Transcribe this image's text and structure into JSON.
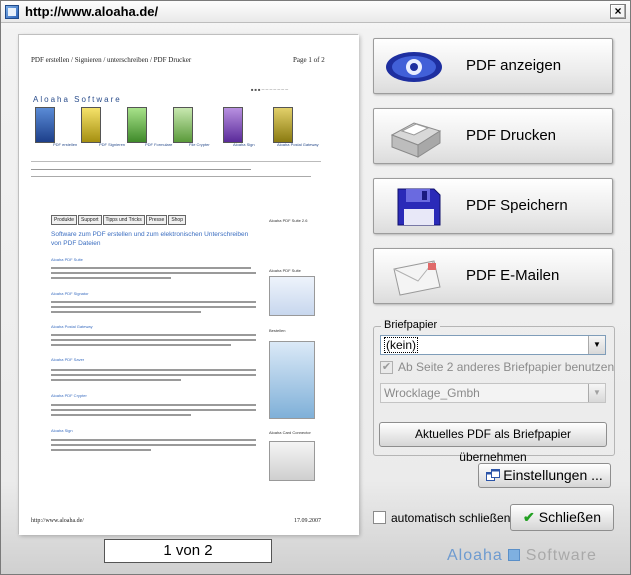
{
  "window": {
    "title": "http://www.aloaha.de/",
    "close_glyph": "×"
  },
  "preview": {
    "header_left": "PDF erstellen / Signieren / unterschreiben / PDF Drucker",
    "header_right": "Page 1 of 2",
    "logo": "Aloaha Software",
    "footer_left": "http://www.aloaha.de/",
    "footer_right": "17.09.2007",
    "products": [
      "PDF erstellen",
      "PDF Signieren",
      "PDF Formulare",
      "File Crypter",
      "Aloaha Sign",
      "Aloaha Postal Gateway"
    ],
    "tabs": [
      "Produkte",
      "Support",
      "Tipps und Tricks",
      "Presse",
      "Shop"
    ],
    "heading": "Software zum PDF erstellen und zum elektronischen Unterschreiben von PDF Dateien",
    "sections": [
      "Aloaha PDF Suite",
      "Aloaha PDF Signator",
      "Aloaha Postal Gateway",
      "Aloaha PDF Saver",
      "Aloaha PDF Crypter",
      "Aloaha Sign"
    ],
    "side_labels": [
      "Aloaha PDF Suite 2.6",
      "Aloaha PDF Suite",
      "Bestellen",
      "Aloaha Card Connector"
    ]
  },
  "page_counter": "1 von 2",
  "actions": [
    {
      "label": "PDF anzeigen",
      "icon": "eye-icon"
    },
    {
      "label": "PDF Drucken",
      "icon": "printer-icon"
    },
    {
      "label": "PDF Speichern",
      "icon": "floppy-disk-icon"
    },
    {
      "label": "PDF E-Mailen",
      "icon": "envelope-icon"
    }
  ],
  "briefpapier": {
    "group_label": "Briefpapier",
    "selected": "(kein)",
    "page2_checkbox_label": "Ab Seite 2 anderes Briefpapier benutzen",
    "page2_checked": true,
    "page2_selected": "Wrocklage_Gmbh",
    "apply_button": "Aktuelles PDF als Briefpapier übernehmen"
  },
  "settings_button": "Einstellungen ...",
  "auto_close_label": "automatisch schließen",
  "auto_close_checked": false,
  "close_button": "Schließen",
  "brand": {
    "part1": "Aloaha",
    "part2": "Software"
  }
}
